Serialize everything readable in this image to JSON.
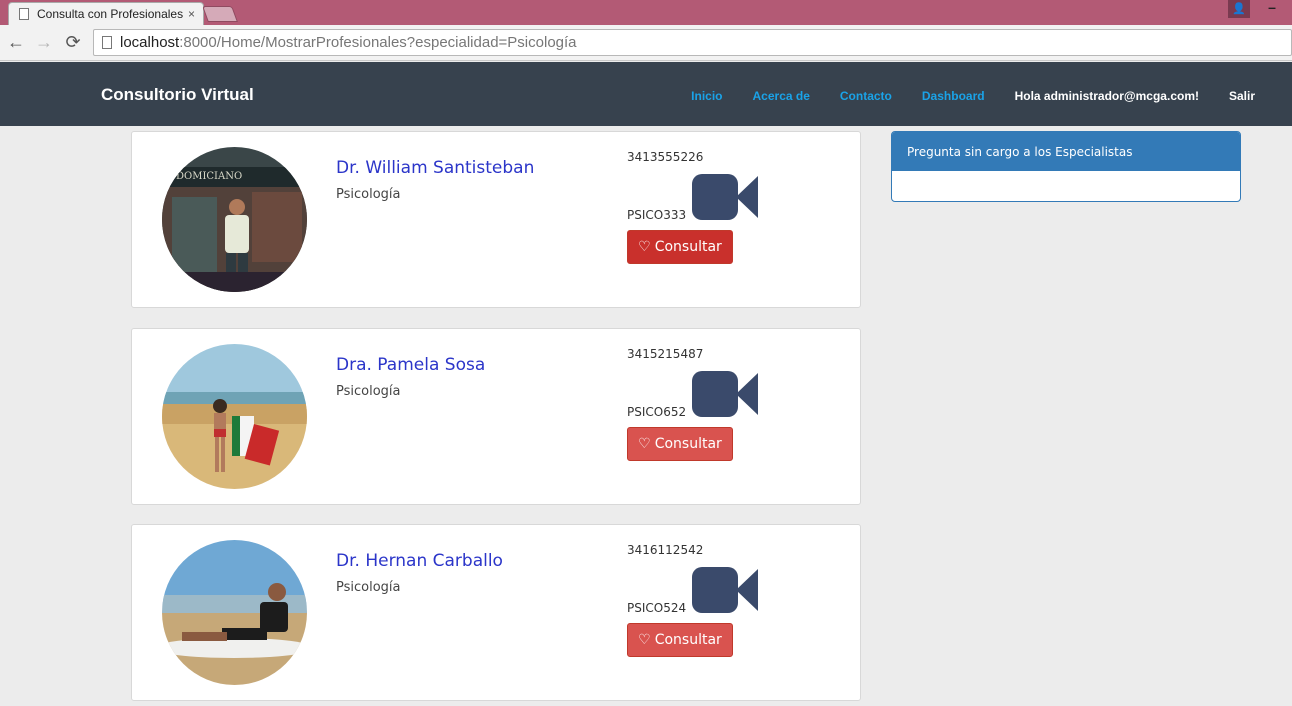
{
  "browser": {
    "tab_title": "Consulta con Profesionales",
    "tab_close": "×",
    "url_host": "localhost",
    "url_rest": ":8000/Home/MostrarProfesionales?especialidad=Psicología",
    "back_icon": "←",
    "forward_icon": "→",
    "reload_icon": "⟳",
    "user_icon": "👤",
    "minimize_icon": "–"
  },
  "navbar": {
    "brand": "Consultorio Virtual",
    "links": [
      "Inicio",
      "Acerca de",
      "Contacto",
      "Dashboard"
    ],
    "greeting": "Hola administrador@mcga.com!",
    "logout": "Salir",
    "link_color": "#1aa3e8",
    "bg_color": "#37424e"
  },
  "professionals": [
    {
      "name": "Dr. William Santisteban",
      "specialty": "Psicología",
      "phone": "3413555226",
      "code": "PSICO333",
      "button_label": "Consultar",
      "heart_icon": "♡",
      "avatar_icon": "photo-man-in-store"
    },
    {
      "name": "Dra. Pamela Sosa",
      "specialty": "Psicología",
      "phone": "3415215487",
      "code": "PSICO652",
      "button_label": "Consultar",
      "heart_icon": "♡",
      "avatar_icon": "photo-woman-on-beach"
    },
    {
      "name": "Dr. Hernan Carballo",
      "specialty": "Psicología",
      "phone": "3416112542",
      "code": "PSICO524",
      "button_label": "Consultar",
      "heart_icon": "♡",
      "avatar_icon": "photo-man-on-beach"
    }
  ],
  "sidebar": {
    "panel_title": "Pregunta sin cargo a los Especialistas",
    "panel_color": "#337ab7"
  }
}
